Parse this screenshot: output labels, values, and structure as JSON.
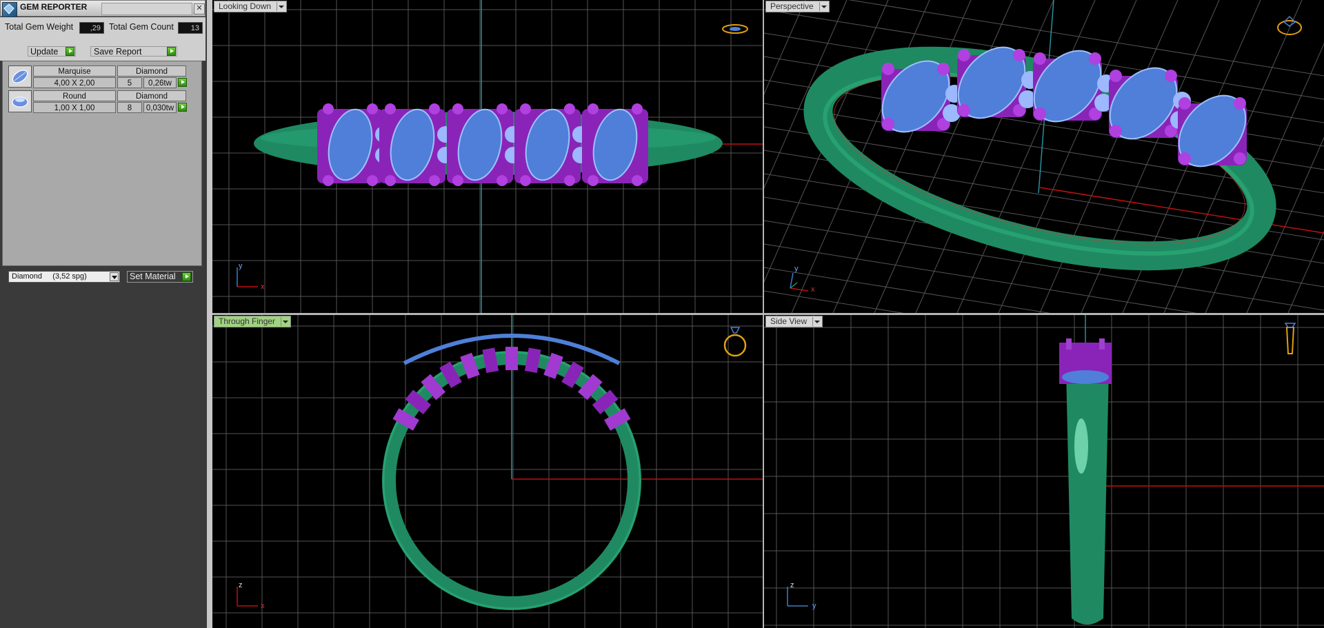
{
  "panel": {
    "title": "GEM REPORTER",
    "close_glyph": "✕",
    "total_weight_label": "Total Gem Weight",
    "total_weight_value": ",29",
    "total_count_label": "Total Gem Count",
    "total_count_value": "13",
    "update_label": "Update",
    "save_report_label": "Save Report",
    "gems": [
      {
        "shape": "Marquise",
        "material": "Diamond",
        "size": "4,00 X 2,00",
        "count": "5",
        "weight": "0,26tw",
        "thumb_icon": "marquise-gem-icon"
      },
      {
        "shape": "Round",
        "material": "Diamond",
        "size": "1,00 X 1,00",
        "count": "8",
        "weight": "0,030tw",
        "thumb_icon": "round-gem-icon"
      }
    ],
    "material_select": "Diamond     (3,52 spg)",
    "set_material_label": "Set Material"
  },
  "viewports": {
    "top_left": {
      "label": "Looking Down",
      "axis_v": "y",
      "axis_h": "x",
      "nav_icon": "ring-top-view-icon"
    },
    "top_right": {
      "label": "Perspective",
      "axis_v": "y",
      "axis_h": "x",
      "nav_icon": "ring-perspective-icon"
    },
    "bottom_left": {
      "label": "Through Finger",
      "axis_v": "z",
      "axis_h": "x",
      "nav_icon": "ring-front-view-icon"
    },
    "bottom_right": {
      "label": "Side View",
      "axis_v": "z",
      "axis_h": "y",
      "nav_icon": "ring-side-view-icon"
    }
  },
  "colors": {
    "band": "#1f8a62",
    "gem": "#4f7fd8",
    "prong": "#8a24b8",
    "grid": "#5a5a5a",
    "axis_red": "#c01010",
    "axis_teal": "#2a8fa0",
    "active_tab": "#9fd37f"
  }
}
